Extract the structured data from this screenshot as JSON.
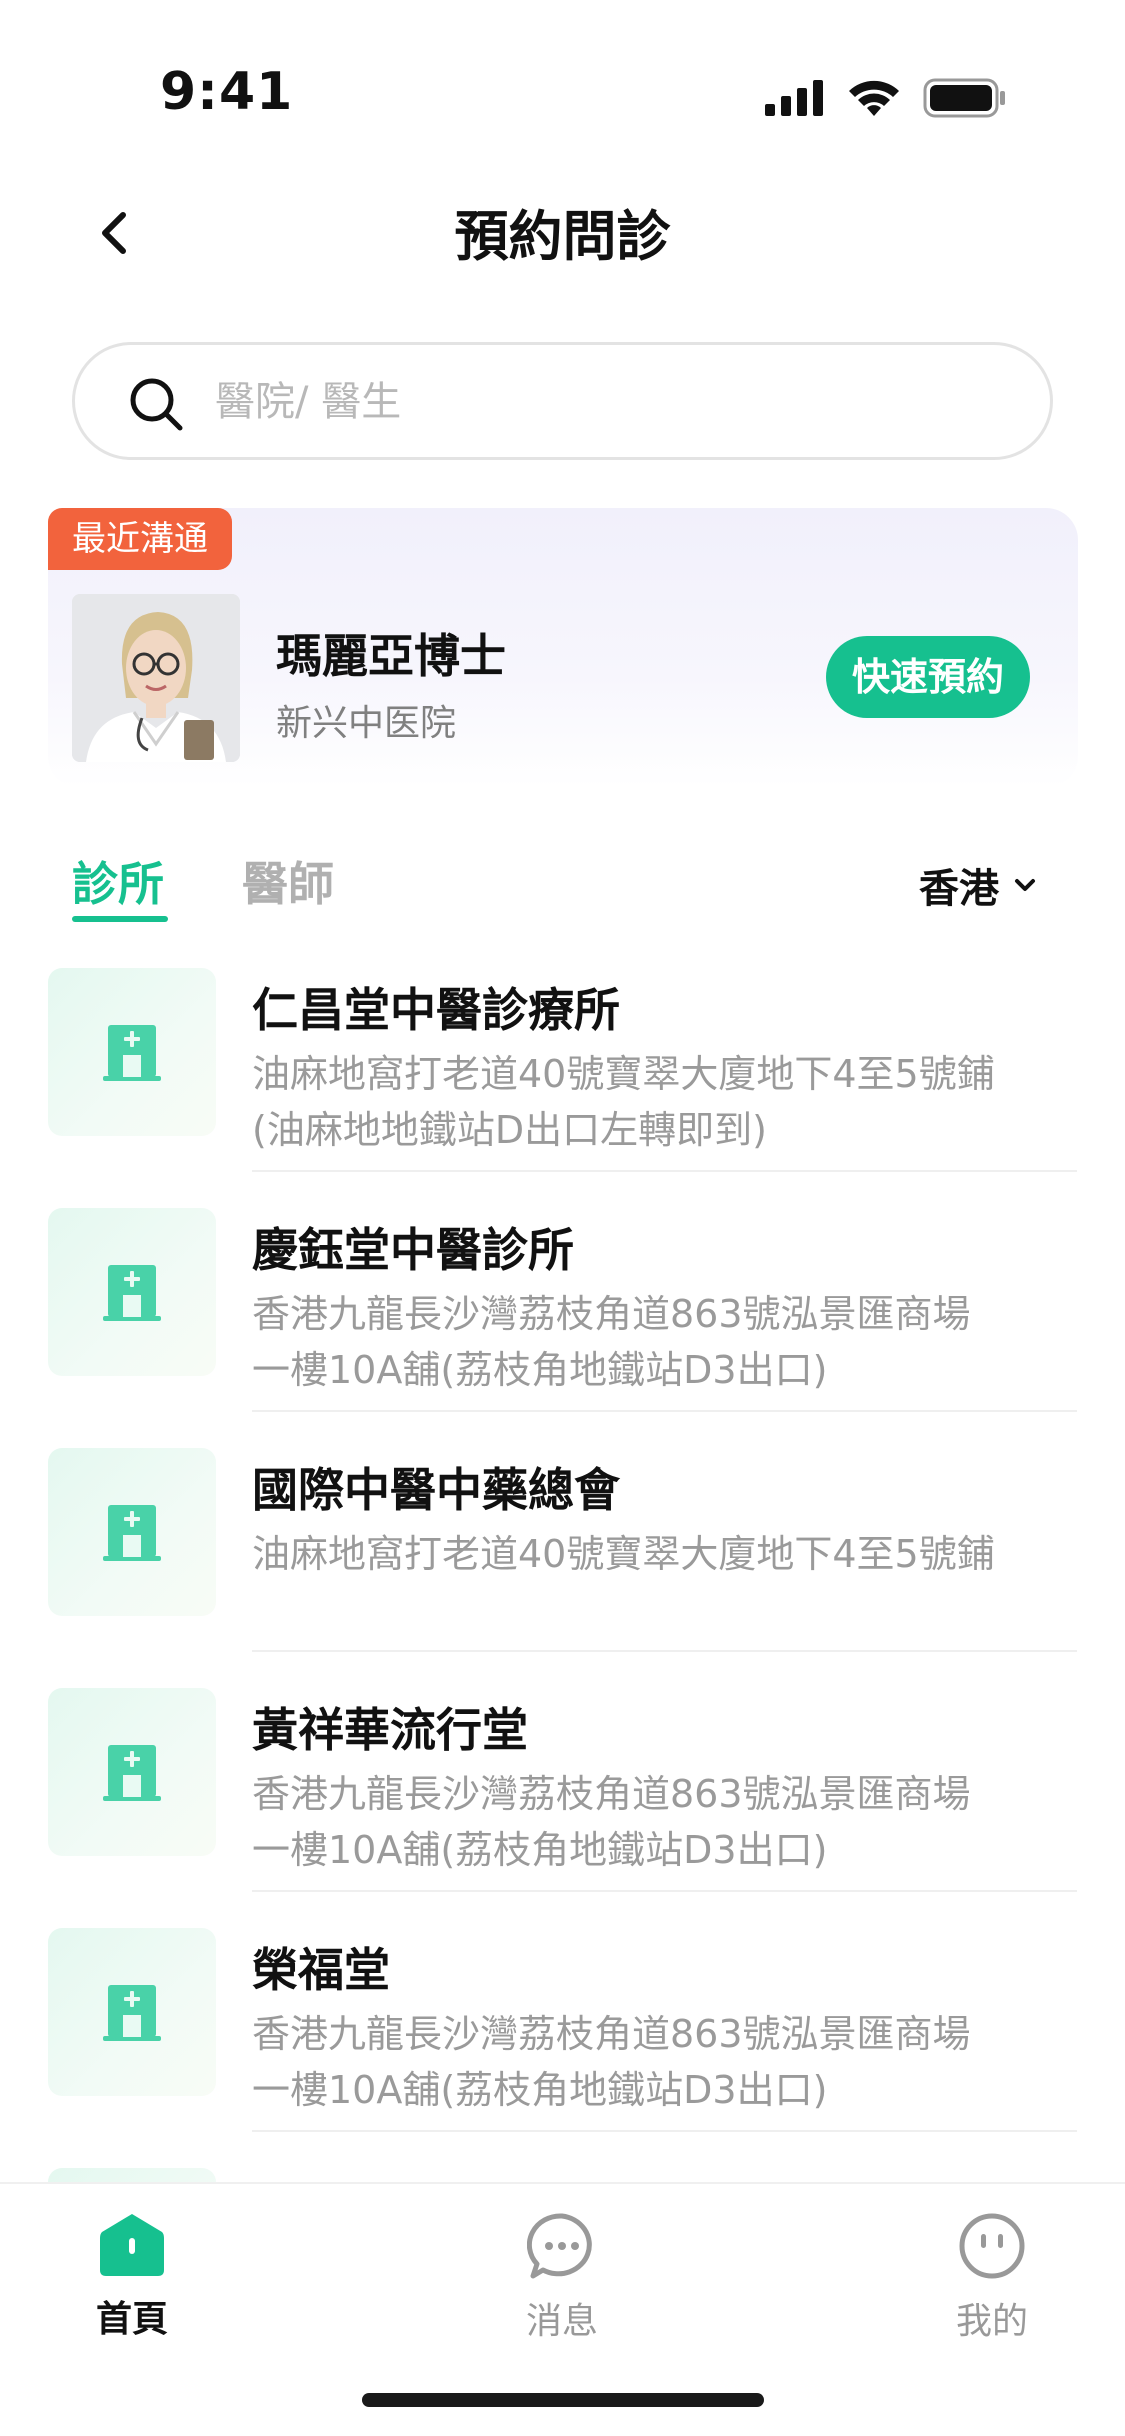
{
  "status_bar": {
    "time": "9:41"
  },
  "header": {
    "title": "預約問診"
  },
  "search": {
    "placeholder": "醫院/ 醫生"
  },
  "recent": {
    "badge": "最近溝通",
    "doctor_name": "瑪麗亞博士",
    "hospital": "新兴中医院",
    "quick_book_label": "快速預約"
  },
  "tabs": [
    {
      "label": "診所",
      "active": true
    },
    {
      "label": "醫師",
      "active": false
    }
  ],
  "region": {
    "value": "香港"
  },
  "clinics": [
    {
      "name": "仁昌堂中醫診療所",
      "address_lines": [
        "油麻地窩打老道40號寶翠大廈地下4至5號鋪",
        "(油麻地地鐵站D出口左轉即到)"
      ]
    },
    {
      "name": "慶鈺堂中醫診所",
      "address_lines": [
        "香港九龍長沙灣荔枝角道863號泓景匯商場",
        "一樓10A舖(荔枝角地鐵站D3出口)"
      ]
    },
    {
      "name": "國際中醫中藥總會",
      "address_lines": [
        "油麻地窩打老道40號寶翠大廈地下4至5號鋪",
        ""
      ]
    },
    {
      "name": "黃祥華流行堂",
      "address_lines": [
        "香港九龍長沙灣荔枝角道863號泓景匯商場",
        "一樓10A舖(荔枝角地鐵站D3出口)"
      ]
    },
    {
      "name": "榮福堂",
      "address_lines": [
        "香港九龍長沙灣荔枝角道863號泓景匯商場",
        "一樓10A舖(荔枝角地鐵站D3出口)"
      ]
    }
  ],
  "bottom_nav": [
    {
      "label": "首頁",
      "icon": "home-icon",
      "active": true
    },
    {
      "label": "消息",
      "icon": "message-icon",
      "active": false
    },
    {
      "label": "我的",
      "icon": "profile-icon",
      "active": false
    }
  ],
  "colors": {
    "accent": "#16c08f",
    "badge": "#f2633d"
  }
}
